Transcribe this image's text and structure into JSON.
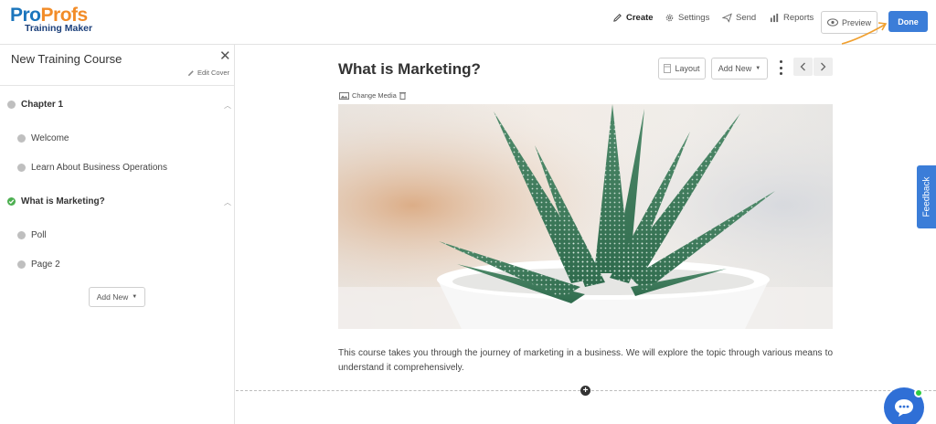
{
  "brand": {
    "logo_pro": "Pro",
    "logo_profs": "Profs",
    "logo_sub": "Training Maker"
  },
  "topnav": {
    "create": "Create",
    "settings": "Settings",
    "send": "Send",
    "reports": "Reports",
    "preview": "Preview",
    "done": "Done"
  },
  "sidebar": {
    "course_title": "New Training Course",
    "edit_cover": "Edit Cover",
    "items": [
      {
        "label": "Chapter 1",
        "type": "chapter",
        "status": "default"
      },
      {
        "label": "Welcome",
        "type": "page",
        "status": "default"
      },
      {
        "label": "Learn About Business Operations",
        "type": "page",
        "status": "default"
      },
      {
        "label": "What is Marketing?",
        "type": "chapter",
        "status": "done"
      },
      {
        "label": "Poll",
        "type": "page",
        "status": "default"
      },
      {
        "label": "Page 2",
        "type": "page",
        "status": "default"
      }
    ],
    "add_new": "Add New"
  },
  "main": {
    "title": "What is Marketing?",
    "layout_label": "Layout",
    "add_new_label": "Add New",
    "change_media": "Change Media",
    "body": "This course takes you through the journey of marketing in a business. We will explore the topic through various means to understand it comprehensively."
  },
  "feedback": "Feedback",
  "colors": {
    "primary": "#3b7dd8",
    "logo_blue": "#1b75bc",
    "logo_orange": "#f28c28",
    "done_check": "#4caf50",
    "online_dot": "#2ecc40"
  }
}
